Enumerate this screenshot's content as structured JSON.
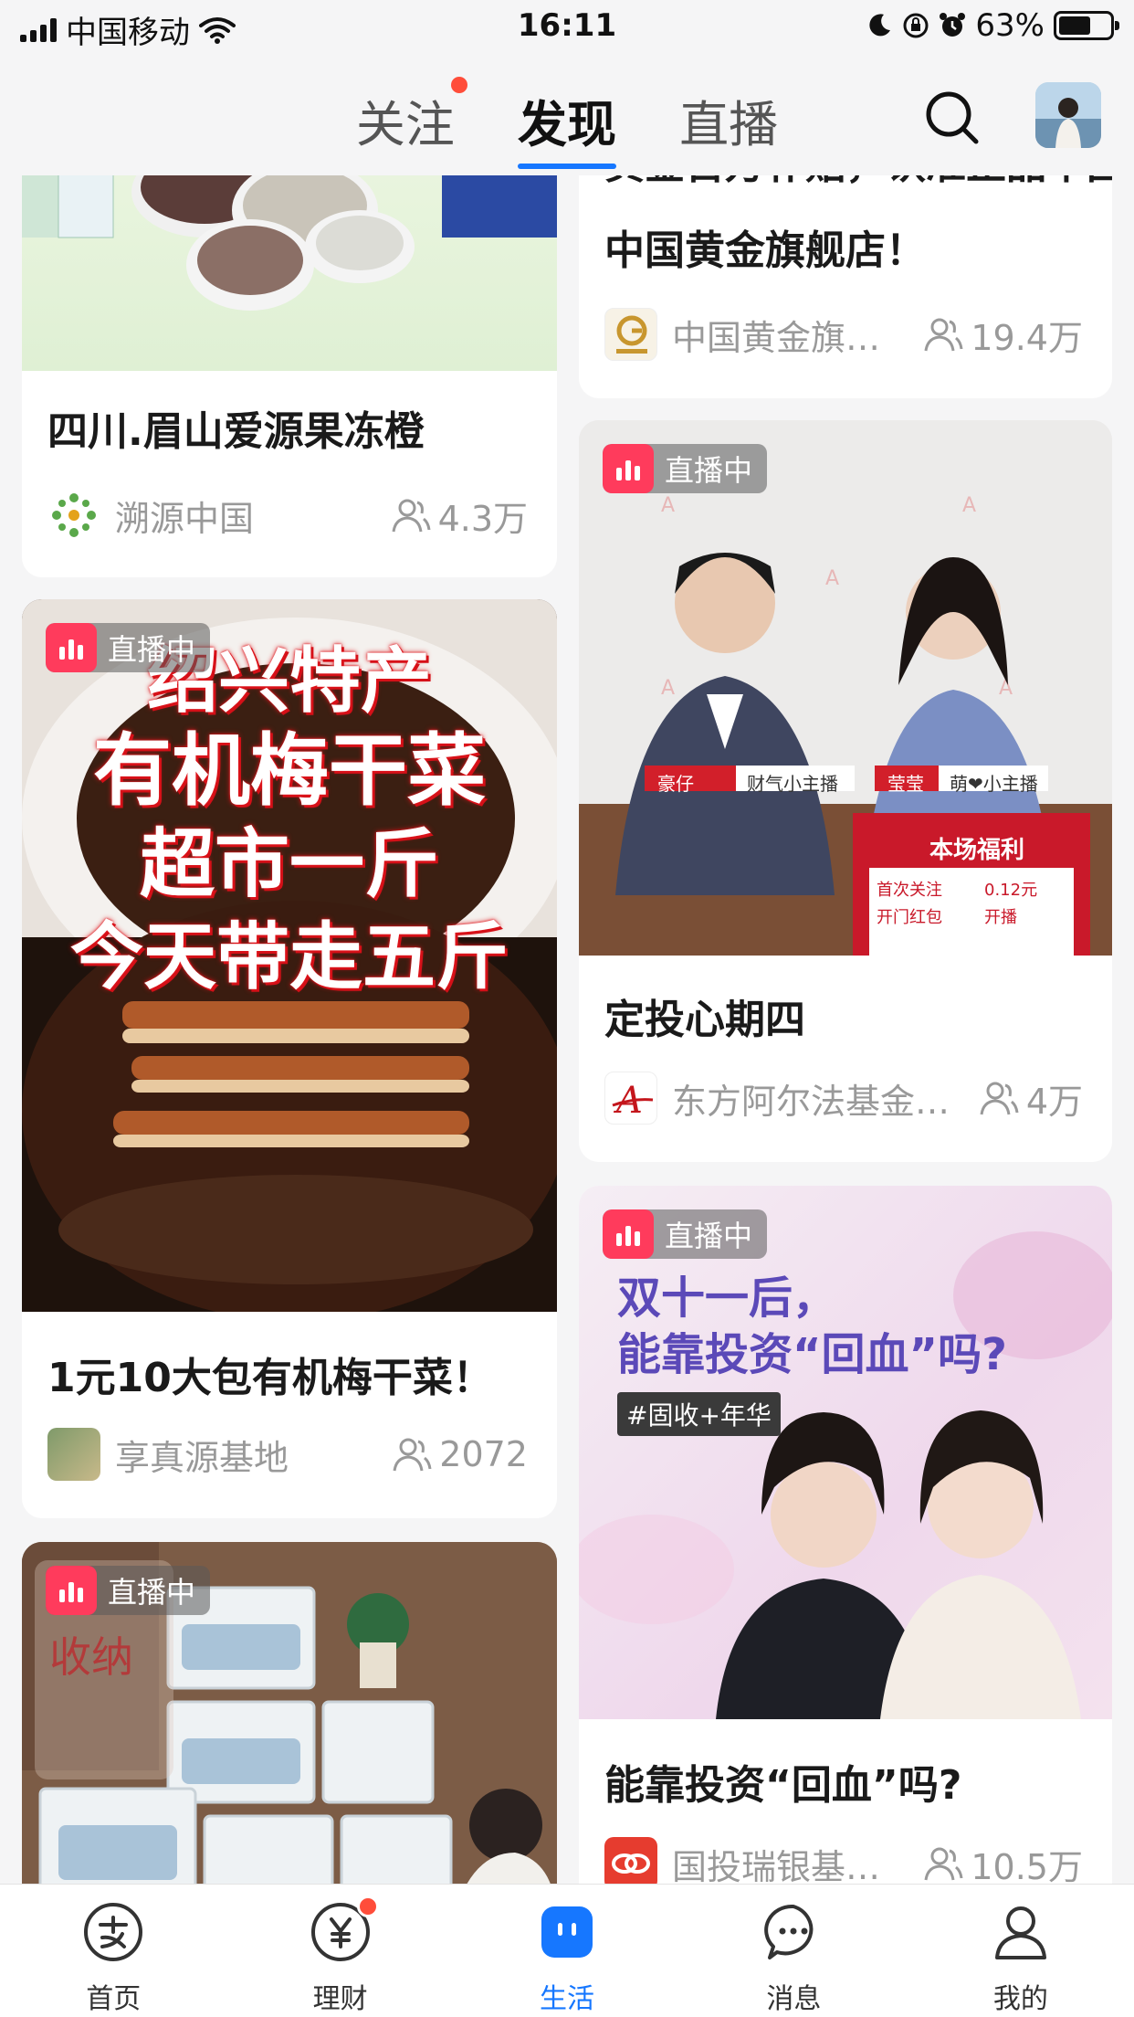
{
  "status_bar": {
    "carrier": "中国移动",
    "time": "16:11",
    "battery": "63%",
    "battery_level": 0.63
  },
  "header": {
    "tabs": [
      {
        "label": "关注",
        "has_dot": true
      },
      {
        "label": "发现",
        "active": true
      },
      {
        "label": "直播"
      }
    ],
    "search_icon": "search-icon",
    "avatar": "user-avatar"
  },
  "feed": {
    "live_label": "直播中",
    "cards": [
      {
        "title": "四川.眉山爱源果冻橙",
        "source": "溯源中国",
        "viewers": "4.3万"
      },
      {
        "title": "黄金百万补贴，认准正品中国黄金旗舰店！",
        "title_line2": "中国黄金旗舰店！",
        "source": "中国黄金旗…",
        "viewers": "19.4万"
      },
      {
        "title": "1元10大包有机梅干菜！",
        "source": "享真源基地",
        "viewers": "2072",
        "overlay_lines": [
          "绍兴特产",
          "有机梅干菜",
          "超市一斤",
          "今天带走五斤"
        ]
      },
      {
        "title": "定投心期四",
        "source": "东方阿尔法基金…",
        "viewers": "4万",
        "overlay_tags": [
          "豪仔",
          "财气小主播",
          "莹莹",
          "萌❤小主播",
          "本场福利",
          "首次关注",
          "0.12元",
          "开门红包",
          "开播"
        ]
      },
      {
        "title": "能靠投资“回血”吗?",
        "source": "国投瑞银基…",
        "viewers": "10.5万",
        "overlay_lines": [
          "双十一后，",
          "能靠投资“回血”吗?"
        ],
        "overlay_tag": "#固收+年华"
      },
      {
        "title": "",
        "source": "",
        "viewers": "",
        "overlay_text": "收纳"
      }
    ]
  },
  "bottom_nav": {
    "items": [
      {
        "label": "首页",
        "icon": "alipay-home-icon"
      },
      {
        "label": "理财",
        "icon": "yuan-wealth-icon",
        "has_dot": true
      },
      {
        "label": "生活",
        "icon": "life-icon",
        "active": true
      },
      {
        "label": "消息",
        "icon": "message-icon"
      },
      {
        "label": "我的",
        "icon": "profile-icon"
      }
    ]
  },
  "colors": {
    "accent": "#1677ff",
    "live_red": "#ff3b5c",
    "badge_dot": "#ff4d3a",
    "background": "#f5f5f6"
  }
}
